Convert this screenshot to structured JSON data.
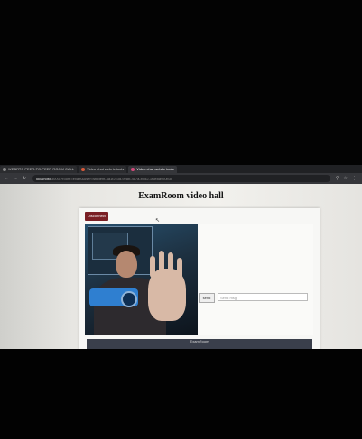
{
  "browser": {
    "tabs": [
      {
        "label": "WEBRTC PEER-TO-PEER ROOM CALL",
        "active": false,
        "color": "#888888"
      },
      {
        "label": "Video chat webrtc tools",
        "active": false,
        "color": "#d65a3a"
      },
      {
        "label": "Video chat webrtc tools",
        "active": true,
        "color": "#d04a7a"
      }
    ],
    "address": {
      "host": "localhost",
      "path": ":3000/?room=exam&user=student-4a1f2c3d-9e8b-4c7a-b5d2-1f6e8a9c0b3d"
    }
  },
  "page": {
    "title": "ExamRoom video hall",
    "disconnect_label": "Disconnect",
    "send_label": "send",
    "message_placeholder": "Send msg",
    "footer_line1": "ExamRoom",
    "footer_line2": ""
  }
}
